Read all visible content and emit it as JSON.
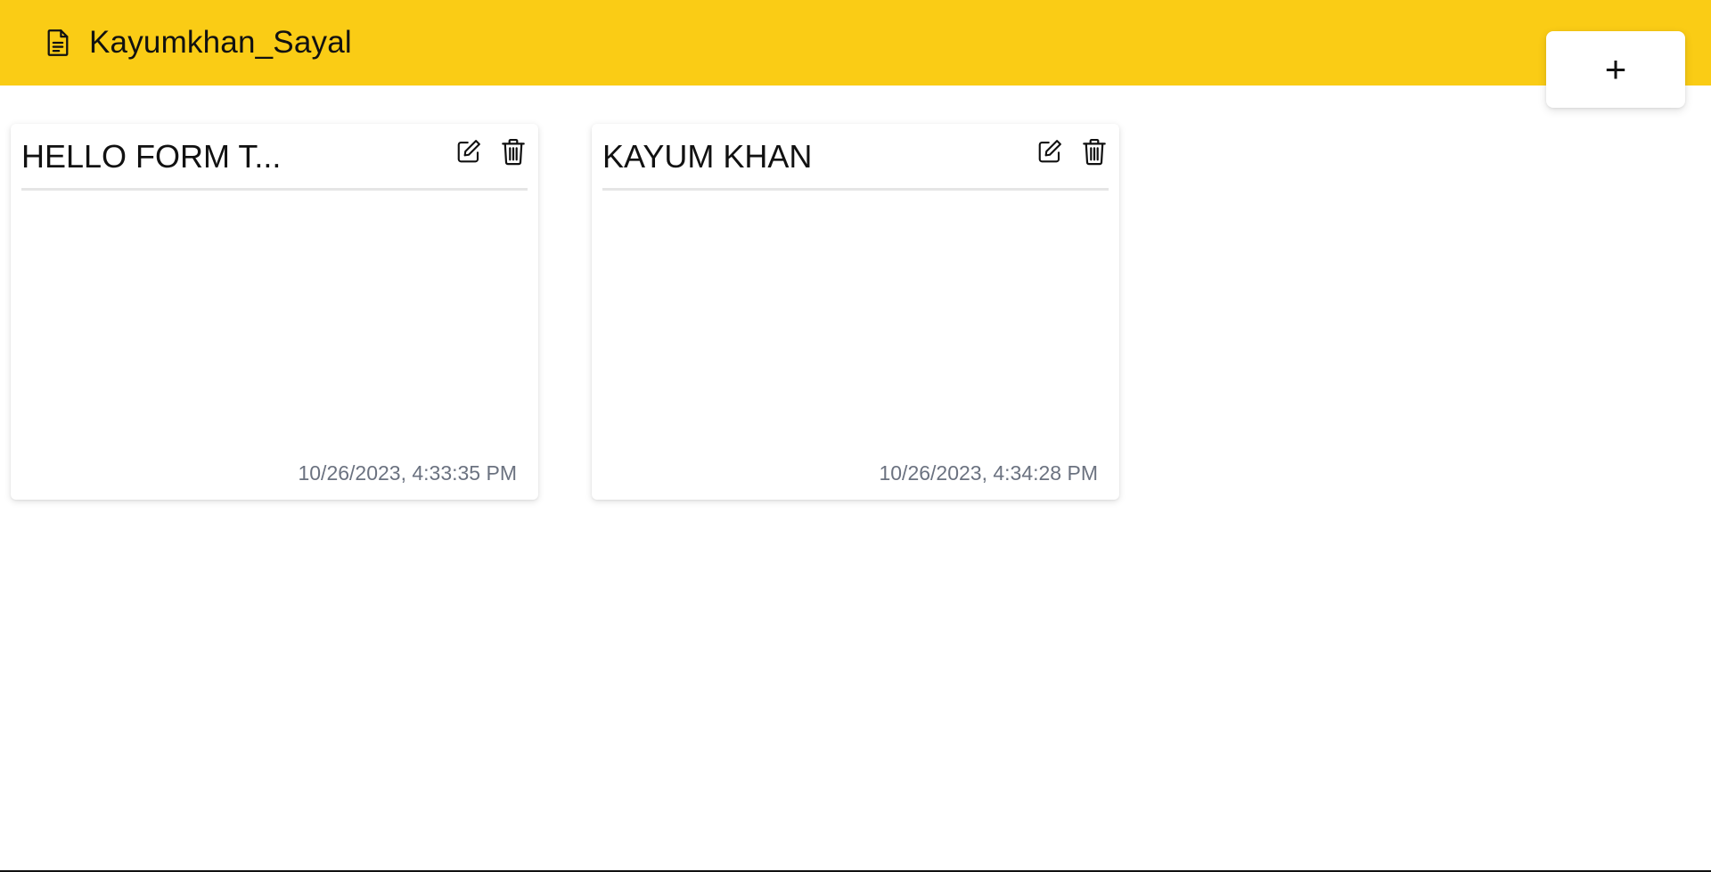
{
  "header": {
    "title": "Kayumkhan_Sayal",
    "icon": "document-icon",
    "background_color": "#facc15"
  },
  "add_button": {
    "label": "+"
  },
  "notes": [
    {
      "title": "HELLO FORM T...",
      "timestamp": "10/26/2023, 4:33:35 PM"
    },
    {
      "title": "KAYUM KHAN",
      "timestamp": "10/26/2023, 4:34:28 PM"
    }
  ]
}
